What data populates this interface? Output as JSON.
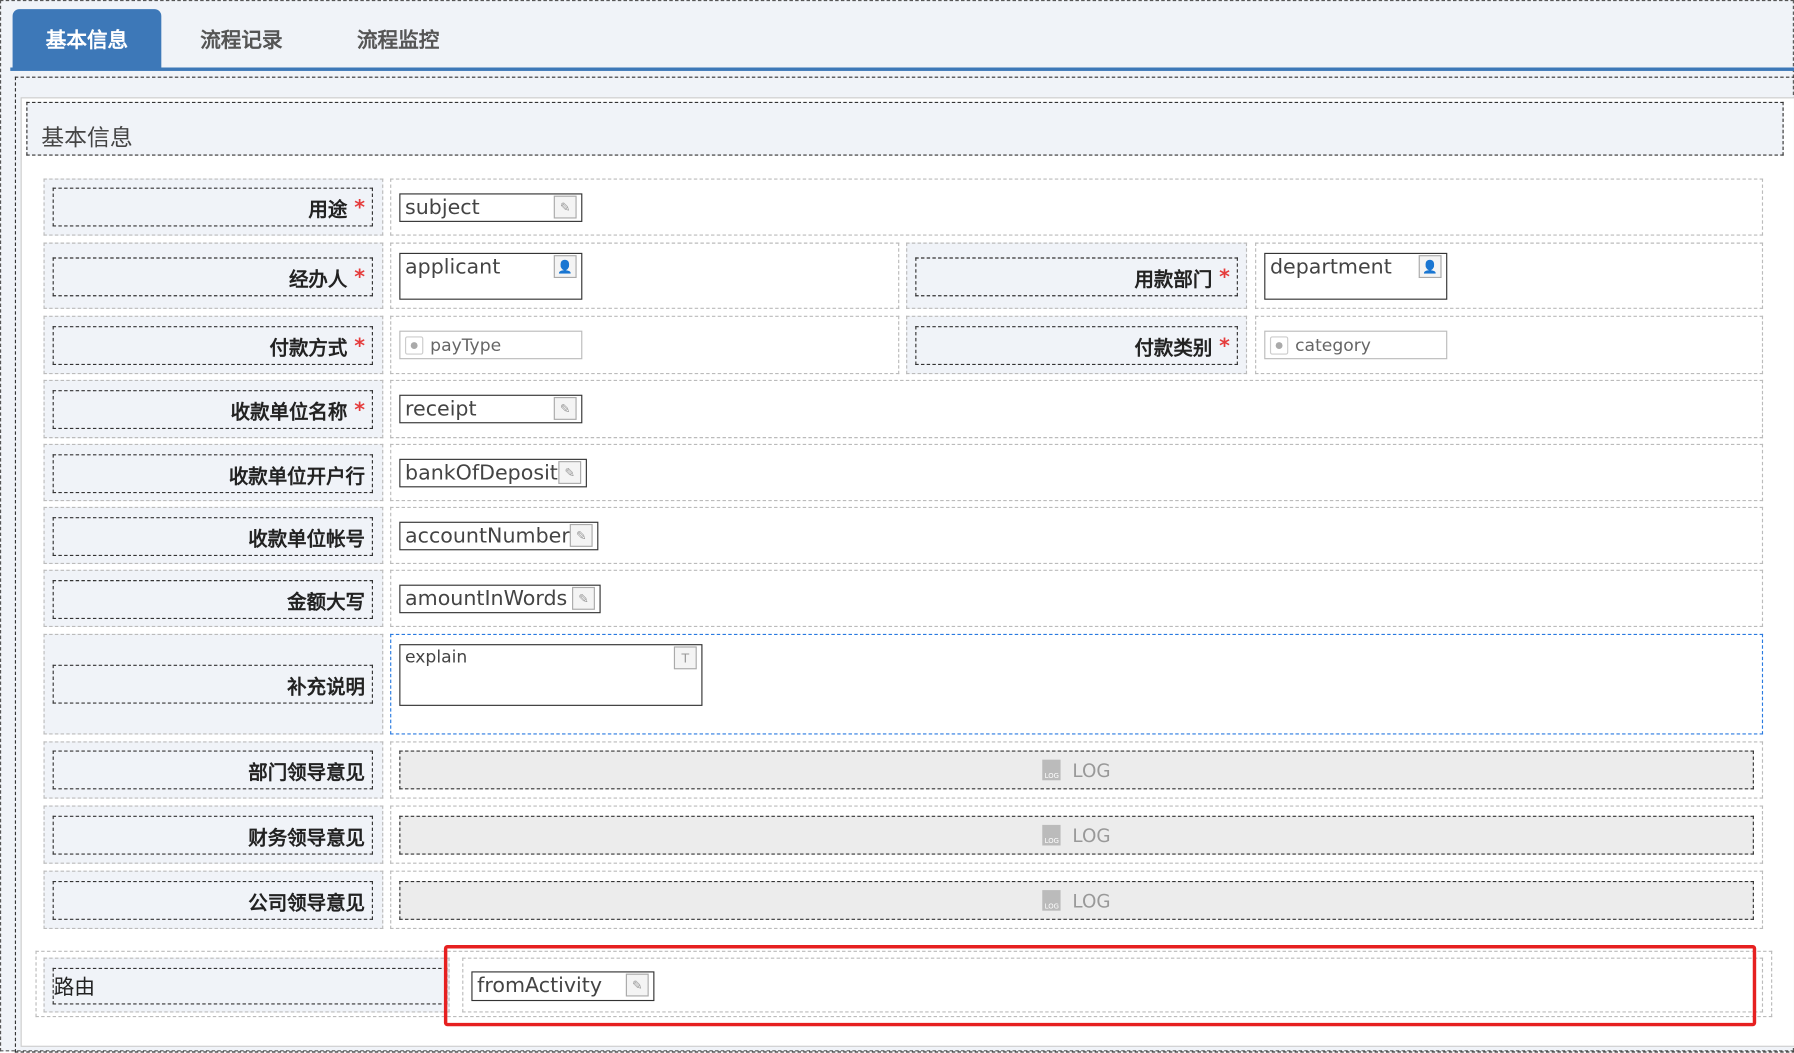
{
  "tabs": [
    {
      "label": "基本信息",
      "active": true
    },
    {
      "label": "流程记录"
    },
    {
      "label": "流程监控"
    }
  ],
  "section_title": "基本信息",
  "fields": {
    "subject": {
      "label": "用途",
      "value": "subject",
      "required": true
    },
    "applicant": {
      "label": "经办人",
      "value": "applicant",
      "required": true
    },
    "department": {
      "label": "用款部门",
      "value": "department",
      "required": true
    },
    "payType": {
      "label": "付款方式",
      "value": "payType",
      "required": true
    },
    "category": {
      "label": "付款类别",
      "value": "category",
      "required": true
    },
    "receipt": {
      "label": "收款单位名称",
      "value": "receipt",
      "required": true
    },
    "bankOfDeposit": {
      "label": "收款单位开户行",
      "value": "bankOfDeposit"
    },
    "accountNumber": {
      "label": "收款单位帐号",
      "value": "accountNumber"
    },
    "amountInWords": {
      "label": "金额大写",
      "value": "amountInWords"
    },
    "explain": {
      "label": "补充说明",
      "value": "explain"
    },
    "deptOpinion": {
      "label": "部门领导意见",
      "value": "LOG"
    },
    "finOpinion": {
      "label": "财务领导意见",
      "value": "LOG"
    },
    "compOpinion": {
      "label": "公司领导意见",
      "value": "LOG"
    },
    "route": {
      "label": "路由",
      "value": "fromActivity"
    }
  },
  "required_mark": "*",
  "colors": {
    "accent": "#3d78b8",
    "required": "#e53c3c",
    "highlight": "#e62020"
  }
}
